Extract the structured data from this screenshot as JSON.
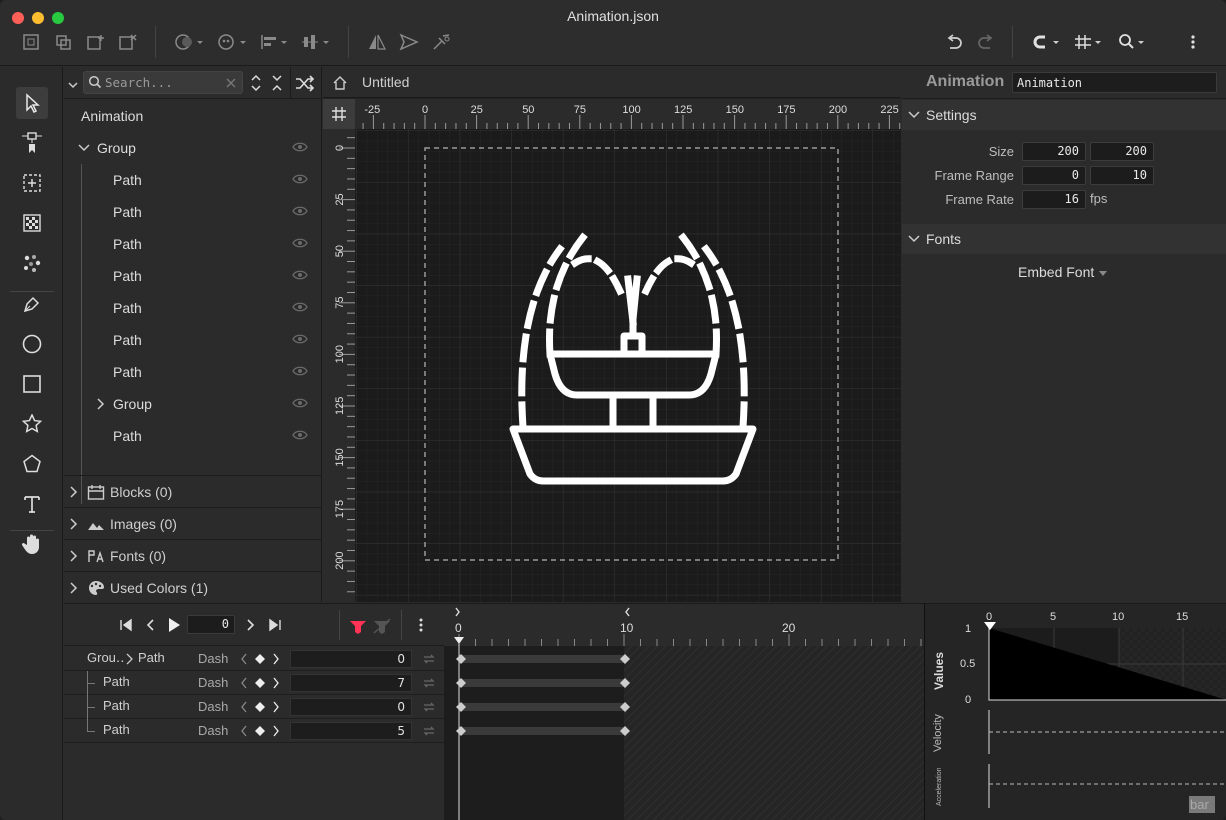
{
  "window": {
    "title": "Animation.json"
  },
  "toolbar": {
    "left_icons": [
      "fit-selection-icon",
      "group-icon",
      "add-artboard-icon",
      "remove-artboard-icon",
      "boolean-op-icon",
      "mask-icon",
      "align-icon",
      "distribute-icon",
      "flip-horizontal-icon",
      "send-icon",
      "pen-pin-icon"
    ],
    "right_icons": [
      "undo-icon",
      "redo-icon",
      "snap-magnet-icon",
      "grid-icon",
      "zoom-icon",
      "more-menu-icon"
    ]
  },
  "tools": [
    "select-arrow-icon",
    "node-select-icon",
    "crop-frame-icon",
    "checker-fill-icon",
    "dots-icon",
    "pen-tool-icon",
    "ellipse-tool-icon",
    "rectangle-tool-icon",
    "star-tool-icon",
    "polygon-tool-icon",
    "text-tool-icon",
    "hand-tool-icon"
  ],
  "tree": {
    "search_placeholder": "Search...",
    "root": "Animation",
    "group_label": "Group",
    "items": [
      "Path",
      "Path",
      "Path",
      "Path",
      "Path",
      "Path",
      "Path",
      "Group",
      "Path"
    ],
    "sections": [
      "Blocks (0)",
      "Images (0)",
      "Fonts (0)",
      "Used Colors (1)"
    ]
  },
  "canvas": {
    "breadcrumb": "Untitled",
    "ruler_x": [
      "-25",
      "0",
      "25",
      "50",
      "75",
      "100",
      "125",
      "150",
      "175",
      "200",
      "225"
    ],
    "ruler_y": [
      "0",
      "25",
      "50",
      "75",
      "100",
      "125",
      "150",
      "175",
      "200"
    ]
  },
  "props": {
    "title": "Animation",
    "name_value": "Animation",
    "settings_label": "Settings",
    "size_label": "Size",
    "size_w": "200",
    "size_h": "200",
    "frame_range_label": "Frame Range",
    "frame_start": "0",
    "frame_end": "10",
    "frame_rate_label": "Frame Rate",
    "frame_rate": "16",
    "fps_unit": "fps",
    "fonts_label": "Fonts",
    "embed_font": "Embed Font"
  },
  "timeline": {
    "current_frame": "0",
    "frame_ticks": [
      "0",
      "10",
      "20"
    ],
    "tracks": [
      {
        "group": "Grou‥",
        "name": "Path",
        "prop": "Dash",
        "value": "0"
      },
      {
        "name": "Path",
        "prop": "Dash",
        "value": "7"
      },
      {
        "name": "Path",
        "prop": "Dash",
        "value": "0"
      },
      {
        "name": "Path",
        "prop": "Dash",
        "value": "5"
      }
    ]
  },
  "graph": {
    "x_ticks": [
      "0",
      "5",
      "10",
      "15"
    ],
    "y_ticks": [
      "1",
      "0.5",
      "0"
    ],
    "values_label": "Values",
    "velocity_label": "Velocity",
    "acceleration_label": "Acceleration",
    "corner_label": "bar"
  },
  "colors": {
    "accent": "#ff3355",
    "canvas_bg": "#1b1b1b",
    "panel": "#2b2b2b"
  }
}
